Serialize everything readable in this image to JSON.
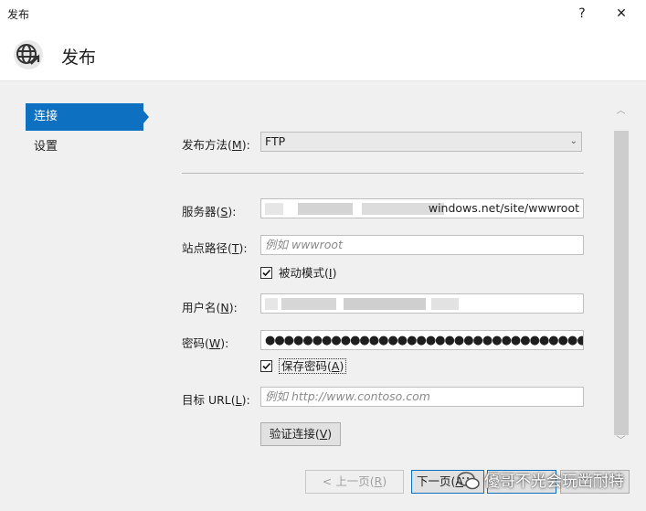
{
  "window": {
    "title": "发布",
    "help_glyph": "?",
    "close_glyph": "✕"
  },
  "header": {
    "title": "发布",
    "icon": "globe-publish-icon"
  },
  "sidebar": {
    "items": [
      {
        "label": "连接",
        "active": true
      },
      {
        "label": "设置",
        "active": false
      }
    ]
  },
  "form": {
    "publish_method": {
      "label": "发布方法(",
      "hotkey": "M",
      "suffix": "):",
      "value": "FTP"
    },
    "server": {
      "label": "服务器(",
      "hotkey": "S",
      "suffix": "):",
      "value_visible": "windows.net/site/wwwroot"
    },
    "site_path": {
      "label": "站点路径(",
      "hotkey": "T",
      "suffix": "):",
      "placeholder": "例如 wwwroot"
    },
    "passive_mode": {
      "label": "被动模式(",
      "hotkey": "I",
      "suffix": ")",
      "checked": true
    },
    "username": {
      "label": "用户名(",
      "hotkey": "N",
      "suffix": "):"
    },
    "password": {
      "label": "密码(",
      "hotkey": "W",
      "suffix": "):",
      "masked": "●●●●●●●●●●●●●●●●●●●●●●●●●●●●●●●●●●●●●●●●●●●●●●●●●●"
    },
    "save_password": {
      "label": "保存密码(",
      "hotkey": "A",
      "suffix": ")",
      "checked": true
    },
    "target_url": {
      "label": "目标 URL(",
      "hotkey": "L",
      "suffix": "):",
      "placeholder": "例如 http://www.contoso.com"
    },
    "validate_button": {
      "label": "验证连接(",
      "hotkey": "V",
      "suffix": ")"
    }
  },
  "footer": {
    "prev_button": {
      "label": "< 上一页(",
      "hotkey": "R",
      "suffix": ")"
    },
    "next_button": {
      "label": "下一页(",
      "hotkey": "A"
    }
  },
  "watermark": {
    "text": "優哥不光会玩凿耐特"
  },
  "colors": {
    "accent": "#0e70c0",
    "panel": "#f0f0f0",
    "white": "#ffffff"
  }
}
